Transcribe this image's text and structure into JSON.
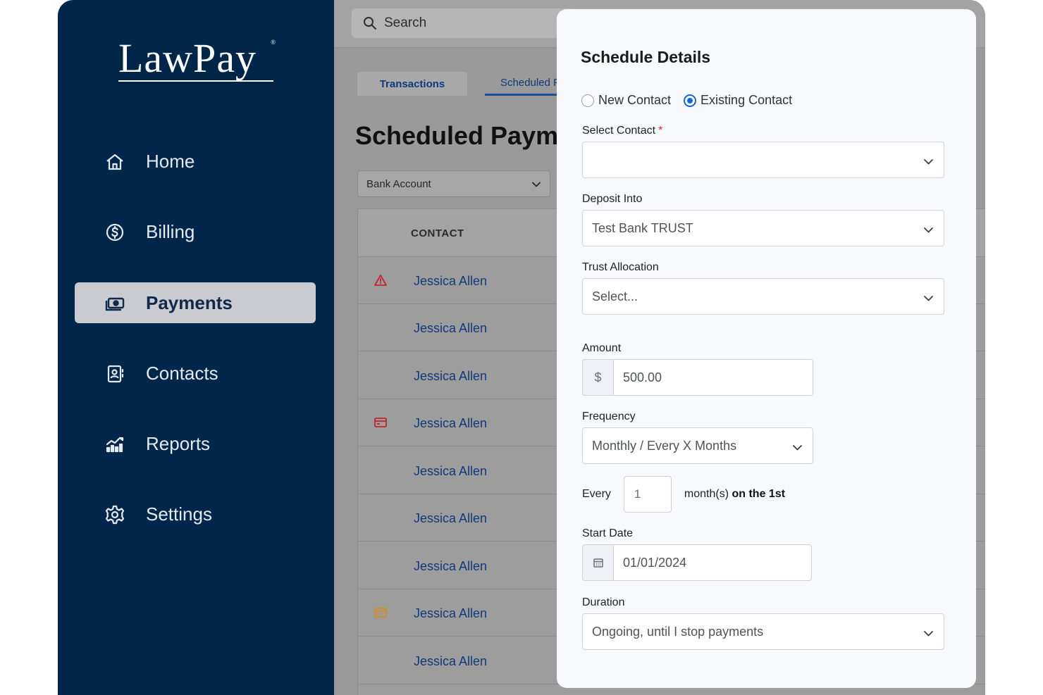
{
  "brand": {
    "logo_text": "LawPay",
    "logo_reg": "®"
  },
  "sidebar": {
    "items": [
      {
        "label": "Home",
        "icon": "home-icon",
        "active": false
      },
      {
        "label": "Billing",
        "icon": "dollar-circle-icon",
        "active": false
      },
      {
        "label": "Payments",
        "icon": "cash-icon",
        "active": true
      },
      {
        "label": "Contacts",
        "icon": "contact-card-icon",
        "active": false
      },
      {
        "label": "Reports",
        "icon": "chart-icon",
        "active": false
      },
      {
        "label": "Settings",
        "icon": "gear-icon",
        "active": false
      }
    ]
  },
  "topbar": {
    "search_placeholder": "Search"
  },
  "tabs": {
    "transactions": "Transactions",
    "scheduled": "Scheduled P"
  },
  "page": {
    "title": "Scheduled Payments"
  },
  "filters": {
    "bank_account": "Bank Account"
  },
  "table": {
    "contact_header": "CONTACT",
    "rows": [
      {
        "name": "Jessica Allen",
        "icon": "warning-icon",
        "icon_color": "#c0272d"
      },
      {
        "name": "Jessica Allen",
        "icon": "",
        "icon_color": ""
      },
      {
        "name": "Jessica Allen",
        "icon": "",
        "icon_color": ""
      },
      {
        "name": "Jessica Allen",
        "icon": "card-icon",
        "icon_color": "#c0272d"
      },
      {
        "name": "Jessica Allen",
        "icon": "",
        "icon_color": ""
      },
      {
        "name": "Jessica Allen",
        "icon": "",
        "icon_color": ""
      },
      {
        "name": "Jessica Allen",
        "icon": "",
        "icon_color": ""
      },
      {
        "name": "Jessica Allen",
        "icon": "card-icon",
        "icon_color": "#d98a1f"
      },
      {
        "name": "Jessica Allen",
        "icon": "",
        "icon_color": ""
      }
    ]
  },
  "modal": {
    "title": "Schedule Details",
    "contact_type": {
      "new_label": "New Contact",
      "existing_label": "Existing Contact",
      "selected": "Existing Contact"
    },
    "select_contact": {
      "label": "Select Contact",
      "required_mark": "*",
      "value": ""
    },
    "deposit_into": {
      "label": "Deposit Into",
      "value": "Test Bank TRUST"
    },
    "trust_allocation": {
      "label": "Trust Allocation",
      "placeholder": "Select..."
    },
    "amount": {
      "label": "Amount",
      "currency": "$",
      "value": "500.00"
    },
    "frequency": {
      "label": "Frequency",
      "value": "Monthly / Every X Months"
    },
    "every": {
      "label": "Every",
      "value": "1",
      "suffix": "month(s)",
      "suffix_bold": "on the 1st"
    },
    "start_date": {
      "label": "Start Date",
      "value": "01/01/2024"
    },
    "duration": {
      "label": "Duration",
      "value": "Ongoing, until I stop payments"
    }
  },
  "colors": {
    "sidebar_bg": "#02264a",
    "accent": "#1466d8",
    "link": "#10397a"
  }
}
